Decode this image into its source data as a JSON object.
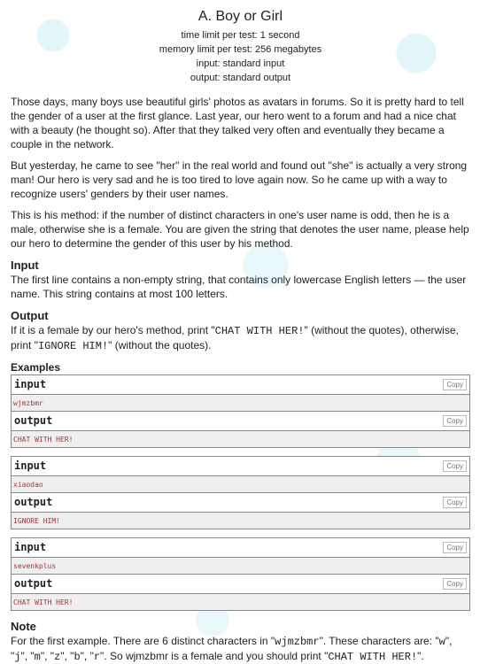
{
  "title": "A. Boy or Girl",
  "header": [
    "time limit per test: 1 second",
    "memory limit per test: 256 megabytes",
    "input: standard input",
    "output: standard output"
  ],
  "legend": [
    "Those days, many boys use beautiful girls' photos as avatars in forums. So it is pretty hard to tell the gender of a user at the first glance. Last year, our hero went to a forum and had a nice chat with a beauty (he thought so). After that they talked very often and eventually they became a couple in the network.",
    "But yesterday, he came to see \"her\" in the real world and found out \"she\" is actually a very strong man! Our hero is very sad and he is too tired to love again now. So he came up with a way to recognize users' genders by their user names.",
    "This is his method: if the number of distinct characters in one's user name is odd, then he is a male, otherwise she is a female. You are given the string that denotes the user name, please help our hero to determine the gender of this user by his method."
  ],
  "input_spec": {
    "title": "Input",
    "text": "The first line contains a non-empty string, that contains only lowercase English letters — the user name. This string contains at most 100 letters."
  },
  "output_spec": {
    "title": "Output",
    "t1": "If it is a female by our hero's method, print \"",
    "m1": "CHAT WITH HER!",
    "t2": "\" (without the quotes), otherwise, print \"",
    "m2": "IGNORE HIM!",
    "t3": "\" (without the quotes)."
  },
  "examples_title": "Examples",
  "input_label": "input",
  "output_label": "output",
  "copy_label": "Copy",
  "samples": [
    {
      "input": "wjmzbmr",
      "output": "CHAT WITH HER!"
    },
    {
      "input": "xiaodao",
      "output": "IGNORE HIM!"
    },
    {
      "input": "sevenkplus",
      "output": "CHAT WITH HER!"
    }
  ],
  "note": {
    "title": "Note",
    "segments": [
      {
        "t": "For the first example. There are 6 distinct characters in \""
      },
      {
        "m": "wjmzbmr"
      },
      {
        "t": "\". These characters are: \""
      },
      {
        "m": "w"
      },
      {
        "t": "\", \""
      },
      {
        "m": "j"
      },
      {
        "t": "\", \""
      },
      {
        "m": "m"
      },
      {
        "t": "\", \""
      },
      {
        "m": "z"
      },
      {
        "t": "\", \""
      },
      {
        "m": "b"
      },
      {
        "t": "\", \""
      },
      {
        "m": "r"
      },
      {
        "t": "\". So wjmzbmr is a female and you should print \""
      },
      {
        "m": "CHAT WITH HER!"
      },
      {
        "t": "\"."
      }
    ]
  }
}
